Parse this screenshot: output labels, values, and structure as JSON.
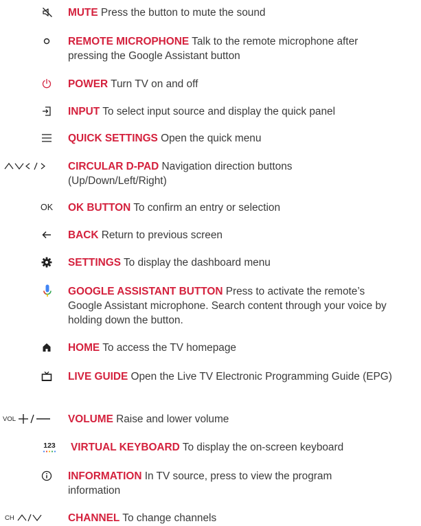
{
  "items": [
    {
      "term": "MUTE",
      "desc": "Press the button to mute the sound",
      "icon": "mute-icon"
    },
    {
      "term": "REMOTE MICROPHONE",
      "desc": "Talk to the remote microphone after pressing the Google Assistant button",
      "icon": "microphone-dot-icon"
    },
    {
      "term": "POWER",
      "desc": "Turn TV on and off",
      "icon": "power-icon"
    },
    {
      "term": "INPUT",
      "desc": "To select input source and display the quick panel",
      "icon": "input-icon"
    },
    {
      "term": "QUICK SETTINGS",
      "desc": "Open the quick menu",
      "icon": "menu-icon"
    },
    {
      "term": "CIRCULAR D-PAD",
      "desc": "Navigation direction buttons (Up/Down/Left/Right)",
      "icon": "dpad-arrows-icon"
    },
    {
      "term": "OK BUTTON",
      "desc": "To confirm an entry or selection",
      "icon": "ok-icon",
      "icon_text": "OK"
    },
    {
      "term": "BACK",
      "desc": "Return to previous screen",
      "icon": "back-arrow-icon"
    },
    {
      "term": "SETTINGS",
      "desc": "To display the dashboard menu",
      "icon": "gear-icon"
    },
    {
      "term": "GOOGLE ASSISTANT BUTTON",
      "desc": "Press to activate the remote’s Google Assistant microphone. Search content through your voice by holding down the button.",
      "icon": "google-assistant-mic-icon"
    },
    {
      "term": "HOME",
      "desc": "To access the TV homepage",
      "icon": "home-icon"
    },
    {
      "term": "LIVE GUIDE",
      "desc": "Open the Live TV Electronic Programming Guide (EPG)",
      "icon": "live-tv-icon"
    },
    {
      "term": "VOLUME",
      "desc": "Raise and lower volume",
      "icon": "volume-icon",
      "icon_text": "VOL"
    },
    {
      "term": "VIRTUAL KEYBOARD",
      "desc": "To display the on-screen keyboard",
      "icon": "keyboard-123-icon",
      "icon_text": "123"
    },
    {
      "term": "INFORMATION",
      "desc": "In TV source, press to view the program information",
      "icon": "info-icon"
    },
    {
      "term": "CHANNEL",
      "desc": "To change channels",
      "icon": "channel-icon",
      "icon_text": "CH"
    }
  ],
  "colors": {
    "term": "#d4213d",
    "text": "#3a3a3a",
    "icon": "#222222",
    "power": "#d4213d",
    "assistant_blue": "#4285f4",
    "assistant_red": "#ea4335",
    "assistant_yellow": "#fbbc05",
    "assistant_green": "#34a853"
  }
}
